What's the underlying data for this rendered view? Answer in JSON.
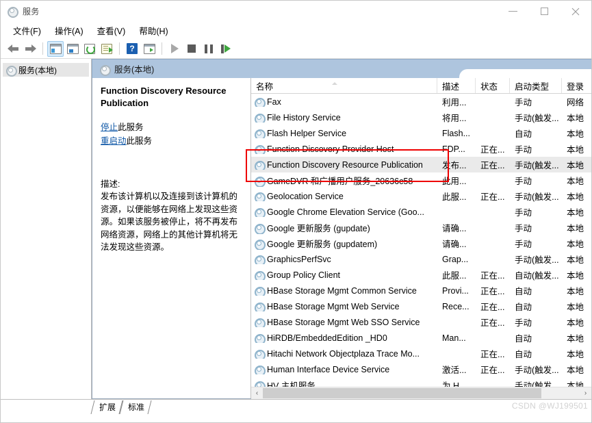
{
  "window": {
    "title": "服务",
    "icon": "gear-icon",
    "controls": {
      "minimize": "—",
      "maximize": "□",
      "close": "✕"
    }
  },
  "menu": [
    {
      "label": "文件(F)",
      "name": "menu-file"
    },
    {
      "label": "操作(A)",
      "name": "menu-action"
    },
    {
      "label": "查看(V)",
      "name": "menu-view"
    },
    {
      "label": "帮助(H)",
      "name": "menu-help"
    }
  ],
  "toolbar": [
    {
      "name": "back-icon",
      "title": "后退"
    },
    {
      "name": "forward-icon",
      "title": "前进"
    },
    {
      "name": "show-hide-tree-icon",
      "title": "显示/隐藏控制台树"
    },
    {
      "name": "properties-icon",
      "title": "属性"
    },
    {
      "name": "refresh-icon",
      "title": "刷新"
    },
    {
      "name": "export-list-icon",
      "title": "导出列表"
    },
    {
      "name": "help-icon",
      "title": "帮助"
    },
    {
      "name": "console-view-icon",
      "title": "控制台视图"
    },
    {
      "name": "start-service-icon",
      "title": "启动服务"
    },
    {
      "name": "stop-service-icon",
      "title": "停止服务"
    },
    {
      "name": "pause-service-icon",
      "title": "暂停服务"
    },
    {
      "name": "restart-service-icon",
      "title": "重新启动服务"
    }
  ],
  "tree": {
    "root_label": "服务(本地)"
  },
  "pane_header": {
    "label": "服务(本地)"
  },
  "detail": {
    "title": "Function Discovery Resource Publication",
    "links": [
      {
        "link_text": "停止",
        "suffix": "此服务",
        "name": "stop-service-link"
      },
      {
        "link_text": "重启动",
        "suffix": "此服务",
        "name": "restart-service-link"
      }
    ],
    "desc_label": "描述:",
    "desc_text": "发布该计算机以及连接到该计算机的资源，以便能够在网络上发现这些资源。如果该服务被停止，将不再发布网络资源，网络上的其他计算机将无法发现这些资源。"
  },
  "list": {
    "columns": [
      {
        "label": "名称",
        "key": "name"
      },
      {
        "label": "描述",
        "key": "desc"
      },
      {
        "label": "状态",
        "key": "state"
      },
      {
        "label": "启动类型",
        "key": "start"
      },
      {
        "label": "登录",
        "key": "logon"
      }
    ],
    "sort_column": "名称",
    "sort_direction": "ascending",
    "rows": [
      {
        "name": "Fax",
        "desc": "利用...",
        "state": "",
        "start": "手动",
        "logon": "网络",
        "selected": false
      },
      {
        "name": "File History Service",
        "desc": "将用...",
        "state": "",
        "start": "手动(触发...",
        "logon": "本地",
        "selected": false
      },
      {
        "name": "Flash Helper Service",
        "desc": "Flash...",
        "state": "",
        "start": "自动",
        "logon": "本地",
        "selected": false
      },
      {
        "name": "Function Discovery Provider Host",
        "desc": "FDP...",
        "state": "正在...",
        "start": "手动",
        "logon": "本地",
        "selected": false
      },
      {
        "name": "Function Discovery Resource Publication",
        "desc": "发布...",
        "state": "正在...",
        "start": "手动(触发...",
        "logon": "本地",
        "selected": true
      },
      {
        "name": "GameDVR 和广播用户服务_20636c58",
        "desc": "此用...",
        "state": "",
        "start": "手动",
        "logon": "本地",
        "selected": false
      },
      {
        "name": "Geolocation Service",
        "desc": "此服...",
        "state": "正在...",
        "start": "手动(触发...",
        "logon": "本地",
        "selected": false
      },
      {
        "name": "Google Chrome Elevation Service (Goo...",
        "desc": "",
        "state": "",
        "start": "手动",
        "logon": "本地",
        "selected": false
      },
      {
        "name": "Google 更新服务 (gupdate)",
        "desc": "请确...",
        "state": "",
        "start": "手动",
        "logon": "本地",
        "selected": false
      },
      {
        "name": "Google 更新服务 (gupdatem)",
        "desc": "请确...",
        "state": "",
        "start": "手动",
        "logon": "本地",
        "selected": false
      },
      {
        "name": "GraphicsPerfSvc",
        "desc": "Grap...",
        "state": "",
        "start": "手动(触发...",
        "logon": "本地",
        "selected": false
      },
      {
        "name": "Group Policy Client",
        "desc": "此服...",
        "state": "正在...",
        "start": "自动(触发...",
        "logon": "本地",
        "selected": false
      },
      {
        "name": "HBase Storage Mgmt Common Service",
        "desc": "Provi...",
        "state": "正在...",
        "start": "自动",
        "logon": "本地",
        "selected": false
      },
      {
        "name": "HBase Storage Mgmt Web Service",
        "desc": "Rece...",
        "state": "正在...",
        "start": "自动",
        "logon": "本地",
        "selected": false
      },
      {
        "name": "HBase Storage Mgmt Web SSO Service",
        "desc": "",
        "state": "正在...",
        "start": "手动",
        "logon": "本地",
        "selected": false
      },
      {
        "name": "HiRDB/EmbeddedEdition _HD0",
        "desc": "Man...",
        "state": "",
        "start": "自动",
        "logon": "本地",
        "selected": false
      },
      {
        "name": "Hitachi Network Objectplaza Trace Mo...",
        "desc": "",
        "state": "正在...",
        "start": "自动",
        "logon": "本地",
        "selected": false
      },
      {
        "name": "Human Interface Device Service",
        "desc": "激活...",
        "state": "正在...",
        "start": "手动(触发...",
        "logon": "本地",
        "selected": false
      },
      {
        "name": "HV 主机服务",
        "desc": "为 H...",
        "state": "",
        "start": "手动(触发...",
        "logon": "本地",
        "selected": false
      }
    ]
  },
  "scrollbar": {
    "left_arrow": "‹",
    "right_arrow": "›"
  },
  "footer": {
    "tabs": [
      {
        "label": "扩展",
        "name": "tab-extended"
      },
      {
        "label": "标准",
        "name": "tab-standard"
      }
    ],
    "watermark": "CSDN @WJ199501"
  },
  "annotation": {
    "type": "red-rectangle",
    "color": "#ee0000",
    "target": "Function Discovery Resource Publication"
  }
}
